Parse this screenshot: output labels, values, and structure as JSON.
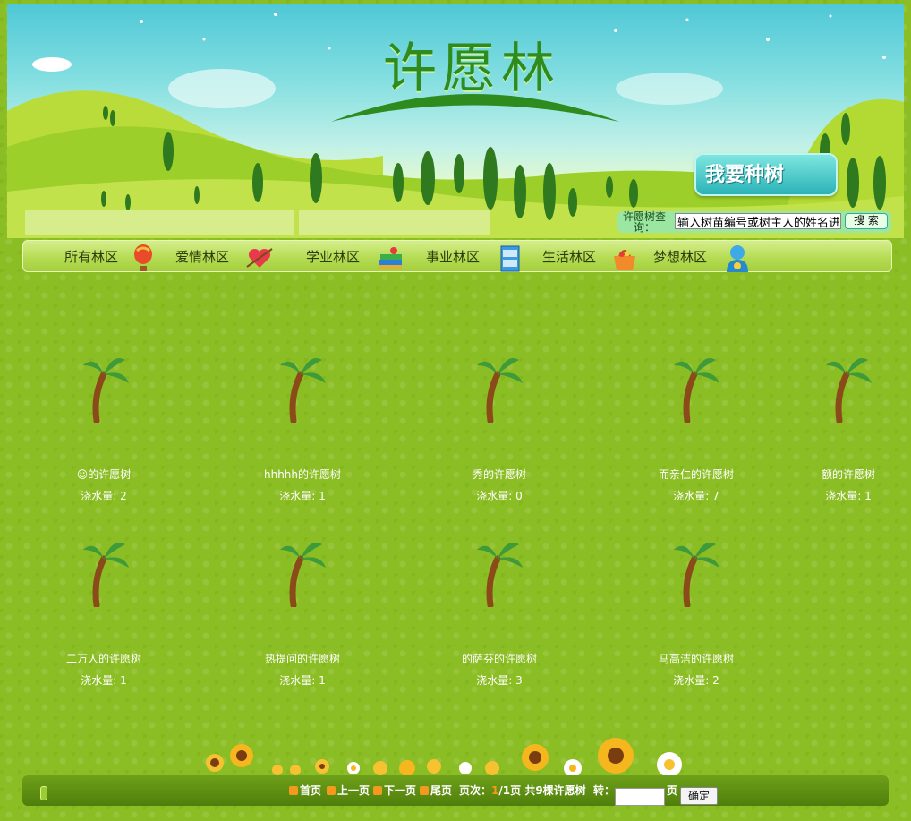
{
  "header": {
    "title": "许愿林",
    "plant_button": "我要种树",
    "search_label": "许愿树查询：",
    "search_placeholder": "输入树苗编号或树主人的姓名进行搜",
    "search_value": "输入树苗编号或树主人的姓名进",
    "search_button": "搜 索"
  },
  "nav": {
    "items": [
      {
        "label": "所有林区",
        "icon": "balloon-icon"
      },
      {
        "label": "爱情林区",
        "icon": "heart-arrow-icon"
      },
      {
        "label": "学业林区",
        "icon": "books-icon"
      },
      {
        "label": "事业林区",
        "icon": "file-cabinet-icon"
      },
      {
        "label": "生活林区",
        "icon": "basket-icon"
      },
      {
        "label": "梦想林区",
        "icon": "person-icon"
      }
    ]
  },
  "trees": [
    {
      "name": "☺的许愿树",
      "water": "浇水量: 2"
    },
    {
      "name": "hhhhh的许愿树",
      "water": "浇水量: 1"
    },
    {
      "name": "秀的许愿树",
      "water": "浇水量: 0"
    },
    {
      "name": "而亲仁的许愿树",
      "water": "浇水量: 7"
    },
    {
      "name": "额的许愿树",
      "water": "浇水量: 1"
    },
    {
      "name": "二万人的许愿树",
      "water": "浇水量: 1"
    },
    {
      "name": "热提问的许愿树",
      "water": "浇水量: 1"
    },
    {
      "name": "的萨芬的许愿树",
      "water": "浇水量: 3"
    },
    {
      "name": "马高洁的许愿树",
      "water": "浇水量: 2"
    }
  ],
  "pager": {
    "first": "首页",
    "prev": "上一页",
    "next": "下一页",
    "last": "尾页",
    "page_prefix": "页次：",
    "current": "1",
    "total": "/1",
    "page_suffix": "页",
    "count_text": "共9棵许愿树",
    "goto_label": "转：",
    "goto_suffix": "页",
    "confirm": "确定"
  },
  "colors": {
    "background": "#8bbd24",
    "tree_leaf": "#3f9a3a",
    "tree_trunk": "#8b4a1a",
    "accent_orange": "#f39a1e"
  }
}
